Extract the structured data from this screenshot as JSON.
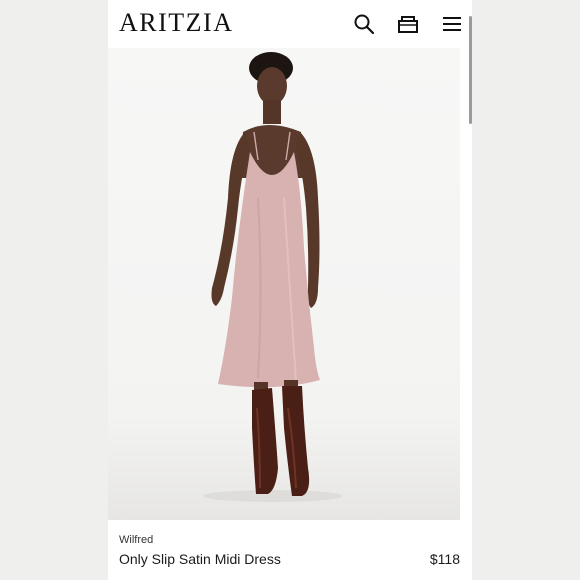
{
  "header": {
    "logo": "ARITZIA",
    "icons": [
      "search-icon",
      "shopping-bag-icon",
      "menu-icon"
    ]
  },
  "hero": {
    "image": "model wearing blush pink satin slip midi dress with tall brown boots",
    "dress_color": "#d7b2b0",
    "boot_color": "#4a1f16"
  },
  "product": {
    "brand": "Wilfred",
    "name": "Only Slip Satin Midi Dress",
    "price": "$118"
  }
}
